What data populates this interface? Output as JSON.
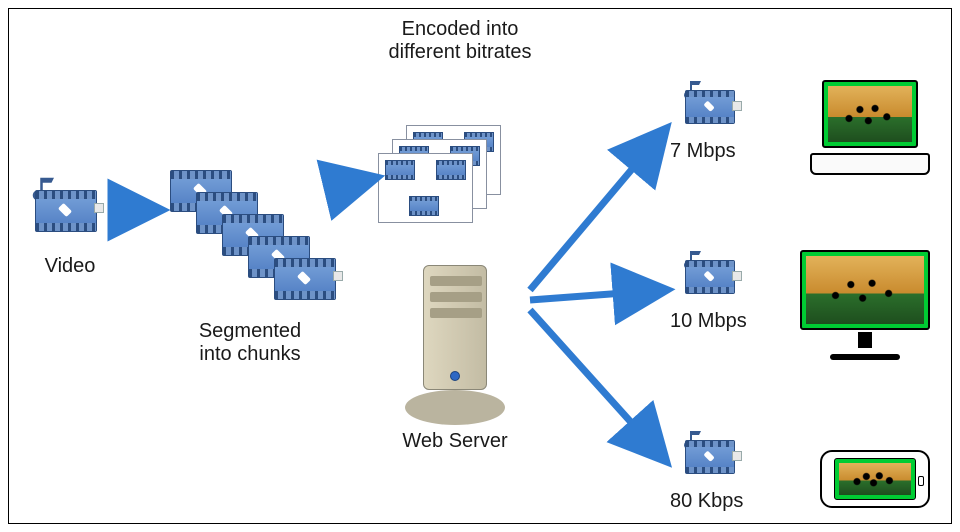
{
  "labels": {
    "title_top": "Encoded into\ndifferent bitrates",
    "video": "Video",
    "segmented": "Segmented\ninto chunks",
    "server": "Web Server",
    "rate1": "7 Mbps",
    "rate2": "10 Mbps",
    "rate3": "80 Kbps"
  },
  "icons": {
    "source": "media-clip-icon",
    "segment": "media-clip-icon",
    "encoded": "encoded-page-icon",
    "server": "server-icon",
    "laptop": "laptop-icon",
    "monitor": "monitor-icon",
    "phone": "phone-icon",
    "arrow": "arrow-right-icon"
  },
  "chart_data": {
    "type": "table",
    "title": "Adaptive bitrate streaming pipeline",
    "flow": [
      "Video",
      "Segmented into chunks",
      "Encoded into different bitrates",
      "Web Server"
    ],
    "outputs": [
      {
        "rate": "7 Mbps",
        "device": "laptop"
      },
      {
        "rate": "10 Mbps",
        "device": "monitor"
      },
      {
        "rate": "80 Kbps",
        "device": "phone"
      }
    ]
  }
}
